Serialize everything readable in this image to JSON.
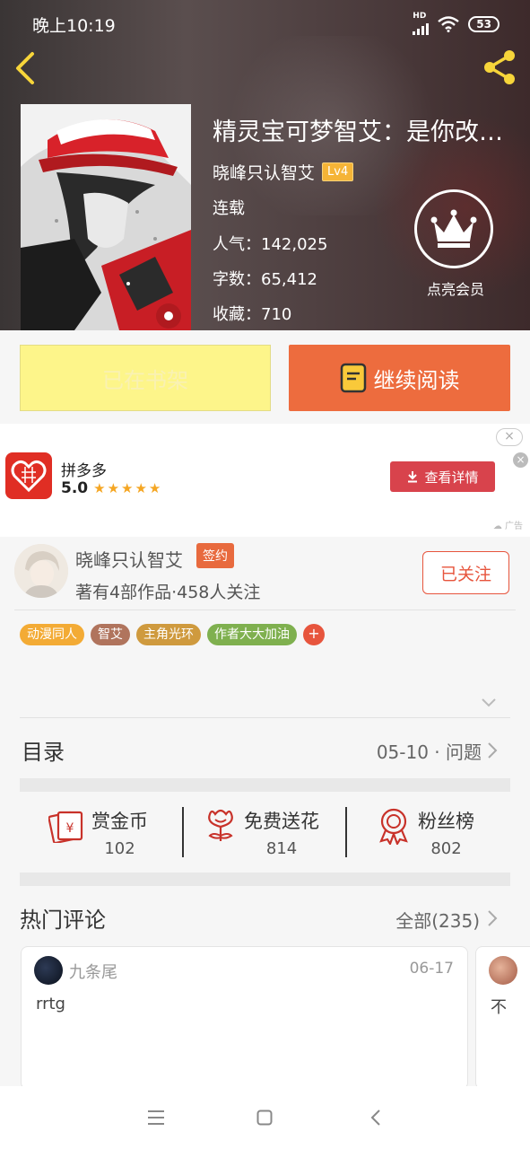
{
  "status": {
    "time": "晚上10:19",
    "network": "HD",
    "battery": "53"
  },
  "book": {
    "title": "精灵宝可梦智艾：是你改变了我",
    "author": "晓峰只认智艾",
    "author_level": "Lv4",
    "state": "连载",
    "popularity_label": "人气：",
    "popularity": "142,025",
    "words_label": "字数：",
    "words": "65,412",
    "favorites_label": "收藏：",
    "favorites": "710"
  },
  "vip": {
    "label": "点亮会员"
  },
  "actions": {
    "shelf_label": "已在书架",
    "read_label": "继续阅读"
  },
  "ad": {
    "app_name": "拼多多",
    "rating": "5.0",
    "stars": "★★★★★",
    "button_label": "查看详情",
    "ad_tag": "广告",
    "close_top": "×",
    "close_x": "×"
  },
  "author_card": {
    "name": "晓峰只认智艾",
    "badge": "签约",
    "stats": "著有4部作品·458人关注",
    "follow_label": "已关注"
  },
  "tags": [
    {
      "label": "动漫同人",
      "color": "#f3ab35"
    },
    {
      "label": "智艾",
      "color": "#b0745d"
    },
    {
      "label": "主角光环",
      "color": "#cf9a3e"
    },
    {
      "label": "作者大大加油",
      "color": "#7fb04f"
    }
  ],
  "tag_plus": "+",
  "catalog": {
    "title": "目录",
    "latest": "05-10 · 问题"
  },
  "stats": [
    {
      "label": "赏金币",
      "value": "102",
      "icon": "coin-envelope-icon"
    },
    {
      "label": "免费送花",
      "value": "814",
      "icon": "flower-icon"
    },
    {
      "label": "粉丝榜",
      "value": "802",
      "icon": "medal-icon"
    }
  ],
  "hot_comments": {
    "title": "热门评论",
    "all_label": "全部(235)",
    "items": [
      {
        "user": "九条尾",
        "date": "06-17",
        "text": "rrtg"
      },
      {
        "user": "",
        "date": "",
        "text": "不"
      }
    ]
  },
  "colors": {
    "accent": "#ed6c3e",
    "follow": "#e7553d",
    "shelf": "#fdf58a",
    "ad_button": "#d8434c"
  }
}
